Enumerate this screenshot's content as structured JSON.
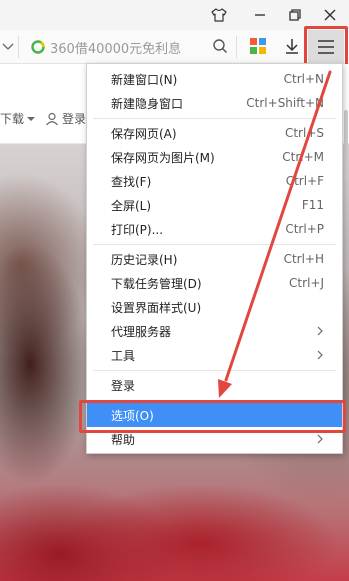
{
  "browser": {
    "search_placeholder": "360借40000元免利息"
  },
  "bookmarks_bar": {
    "download_label": "下载",
    "login_label": "登录"
  },
  "menu": {
    "groups": [
      [
        {
          "label": "新建窗口(N)",
          "shortcut": "Ctrl+N"
        },
        {
          "label": "新建隐身窗口",
          "shortcut": "Ctrl+Shift+N"
        }
      ],
      [
        {
          "label": "保存网页(A)",
          "shortcut": "Ctrl+S"
        },
        {
          "label": "保存网页为图片(M)",
          "shortcut": "Ctrl+M"
        },
        {
          "label": "查找(F)",
          "shortcut": "Ctrl+F"
        },
        {
          "label": "全屏(L)",
          "shortcut": "F11"
        },
        {
          "label": "打印(P)...",
          "shortcut": "Ctrl+P"
        }
      ],
      [
        {
          "label": "历史记录(H)",
          "shortcut": "Ctrl+H"
        },
        {
          "label": "下载任务管理(D)",
          "shortcut": "Ctrl+J"
        },
        {
          "label": "设置界面样式(U)",
          "shortcut": ""
        },
        {
          "label": "代理服务器",
          "shortcut": "",
          "submenu": true
        },
        {
          "label": "工具",
          "shortcut": "",
          "submenu": true
        }
      ],
      [
        {
          "label": "登录",
          "shortcut": ""
        }
      ],
      [
        {
          "label": "选项(O)",
          "shortcut": "",
          "selected": true
        },
        {
          "label": "帮助",
          "shortcut": "",
          "submenu": true
        }
      ]
    ]
  },
  "colors": {
    "selection": "#3f8ff7",
    "annotation": "#e0483f"
  },
  "icons": {
    "skin": "tshirt-icon",
    "minimize": "minimize-icon",
    "restore": "restore-icon",
    "close": "close-icon",
    "search_logo": "360-search-logo-icon",
    "search": "search-icon",
    "apps": "apps-grid-icon",
    "download": "download-icon",
    "menu": "hamburger-menu-icon"
  }
}
